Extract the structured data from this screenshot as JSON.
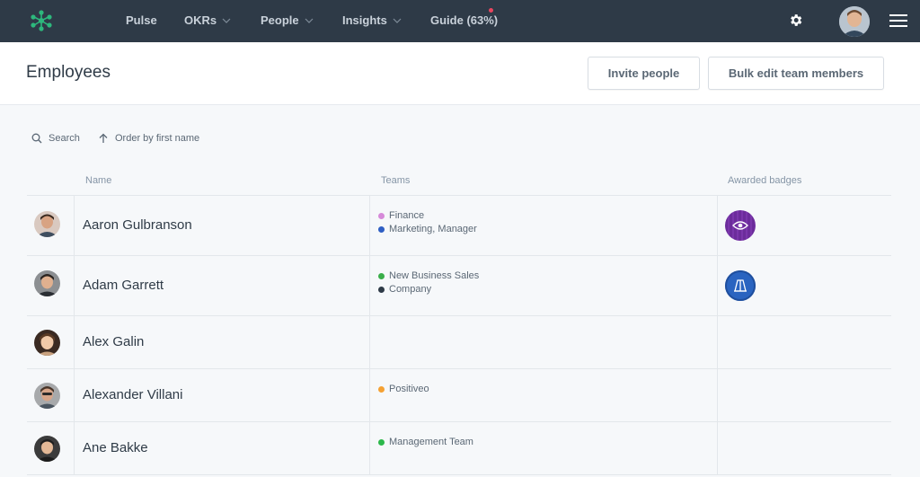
{
  "nav": {
    "items": [
      {
        "label": "Pulse",
        "dropdown": false
      },
      {
        "label": "OKRs",
        "dropdown": true
      },
      {
        "label": "People",
        "dropdown": true
      },
      {
        "label": "Insights",
        "dropdown": true
      },
      {
        "label": "Guide (63%)",
        "dropdown": false
      }
    ],
    "icons": [
      "logo-icon",
      "gear-icon",
      "avatar",
      "hamburger-menu-icon"
    ]
  },
  "header": {
    "title": "Employees",
    "invite_label": "Invite people",
    "bulk_label": "Bulk edit team members"
  },
  "toolbar": {
    "search_label": "Search",
    "order_label": "Order by first name"
  },
  "table": {
    "columns": {
      "name": "Name",
      "teams": "Teams",
      "badges": "Awarded badges"
    },
    "rows": [
      {
        "name": "Aaron Gulbranson",
        "teams": [
          {
            "name": "Finance",
            "color": "#d68ad9"
          },
          {
            "name": "Marketing, Manager",
            "color": "#2f5fc4"
          }
        ],
        "badge": "eye-badge-icon"
      },
      {
        "name": "Adam Garrett",
        "teams": [
          {
            "name": "New Business Sales",
            "color": "#3aae4a"
          },
          {
            "name": "Company",
            "color": "#2e3a47"
          }
        ],
        "badge": "book-badge-icon"
      },
      {
        "name": "Alex Galin",
        "teams": [],
        "badge": ""
      },
      {
        "name": "Alexander Villani",
        "teams": [
          {
            "name": "Positiveo",
            "color": "#f5a133"
          }
        ],
        "badge": ""
      },
      {
        "name": "Ane Bakke",
        "teams": [
          {
            "name": "Management Team",
            "color": "#2cb84b"
          }
        ],
        "badge": ""
      }
    ]
  },
  "colors": {
    "nav_bg": "#2e3a47",
    "accent": "#2db87d",
    "badge_purple": "#6c2c9b",
    "badge_blue": "#2a64c0"
  }
}
